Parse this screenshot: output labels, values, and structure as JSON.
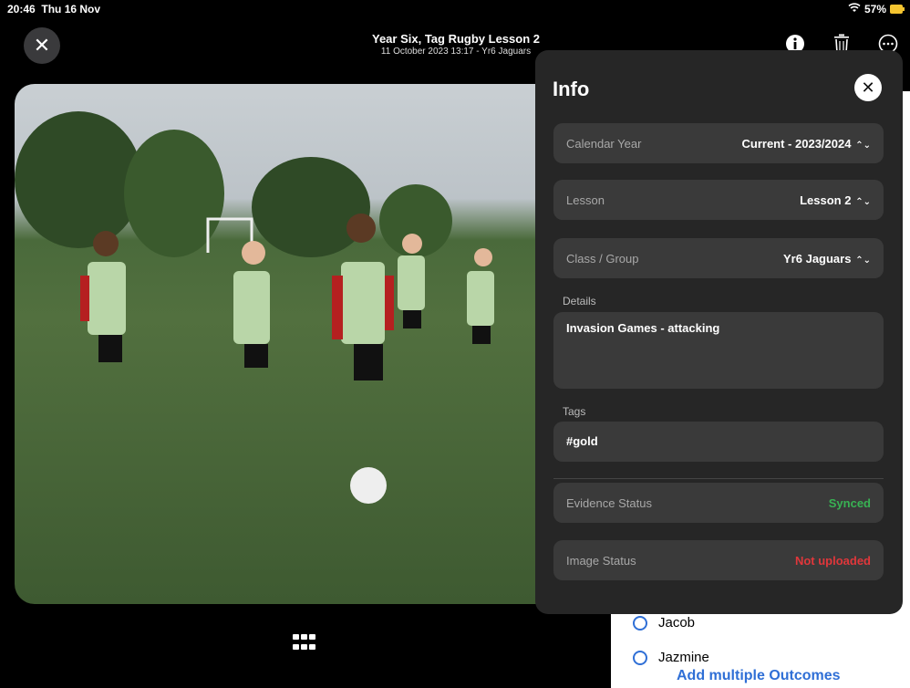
{
  "status_bar": {
    "time": "20:46",
    "date": "Thu 16 Nov",
    "battery": "57%"
  },
  "header": {
    "title": "Year Six, Tag Rugby Lesson 2",
    "subtitle": "11 October 2023 13:17 - Yr6 Jaguars"
  },
  "info": {
    "title": "Info",
    "calendar_year": {
      "label": "Calendar Year",
      "value": "Current - 2023/2024"
    },
    "lesson": {
      "label": "Lesson",
      "value": "Lesson 2"
    },
    "class_group": {
      "label": "Class / Group",
      "value": "Yr6 Jaguars"
    },
    "details_label": "Details",
    "details_value": "Invasion Games - attacking",
    "tags_label": "Tags",
    "tags_value": "#gold",
    "evidence_status": {
      "label": "Evidence Status",
      "value": "Synced"
    },
    "image_status": {
      "label": "Image Status",
      "value": "Not uploaded"
    }
  },
  "students": [
    "Jacob",
    "Jazmine"
  ],
  "add_outcomes_label": "Add multiple Outcomes",
  "colors": {
    "accent": "#2f6fd6",
    "synced": "#38b253",
    "not_uploaded": "#e0373b",
    "panel": "#262626"
  }
}
